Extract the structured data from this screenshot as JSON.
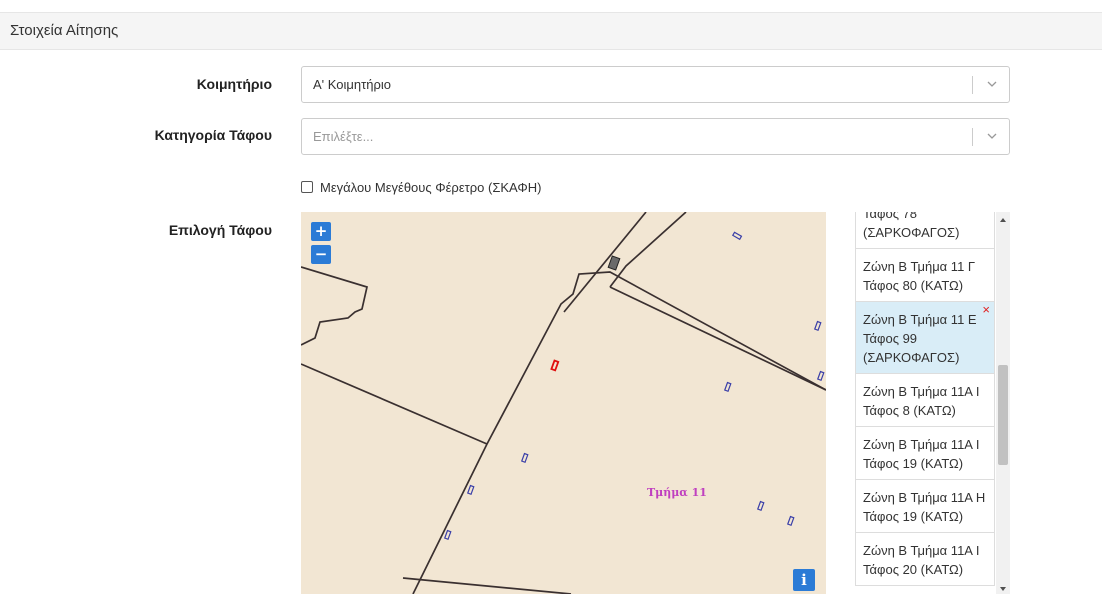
{
  "panel": {
    "title": "Στοιχεία Αίτησης"
  },
  "fields": {
    "cemetery": {
      "label": "Κοιμητήριο",
      "value": "Α' Κοιμητήριο"
    },
    "grave_category": {
      "label": "Κατηγορία Τάφου",
      "placeholder": "Επιλέξτε..."
    },
    "large_coffin": {
      "label": "Μεγάλου Μεγέθους Φέρετρο (ΣΚΑΦΗ)",
      "checked": false
    },
    "grave_selection": {
      "label": "Επιλογή Τάφου"
    }
  },
  "map": {
    "zoom_in": "+",
    "zoom_out": "−",
    "info": "i",
    "section_label": "Τμήμα 11",
    "colors": {
      "background": "#f2e6d3",
      "boundary": "#3a3030",
      "grave": "#3a3fa8",
      "selected_grave": "#e01010",
      "label": "#c040c0"
    }
  },
  "grave_list": {
    "items": [
      {
        "text": "Τάφος 78 (ΣΑΡΚΟΦΑΓΟΣ)",
        "selected": false
      },
      {
        "text": "Ζώνη Β Τμήμα 11 Γ Τάφος 80 (ΚΑΤΩ)",
        "selected": false
      },
      {
        "text": "Ζώνη Β Τμήμα 11 Ε Τάφος 99 (ΣΑΡΚΟΦΑΓΟΣ)",
        "selected": true
      },
      {
        "text": "Ζώνη Β Τμήμα 11Α Ι Τάφος 8 (ΚΑΤΩ)",
        "selected": false
      },
      {
        "text": "Ζώνη Β Τμήμα 11Α Ι Τάφος 19 (ΚΑΤΩ)",
        "selected": false
      },
      {
        "text": "Ζώνη Β Τμήμα 11Α Η Τάφος 19 (ΚΑΤΩ)",
        "selected": false
      },
      {
        "text": "Ζώνη Β Τμήμα 11Α Ι Τάφος 20 (ΚΑΤΩ)",
        "selected": false
      }
    ],
    "remove_symbol": "×"
  }
}
